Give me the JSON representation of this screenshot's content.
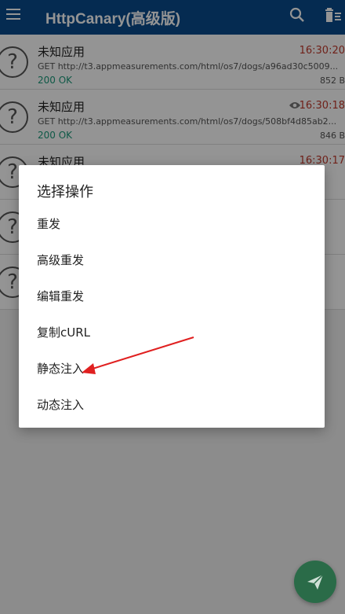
{
  "appbar": {
    "title": "HttpCanary(高级版)"
  },
  "requests": [
    {
      "app": "未知应用",
      "time": "16:30:20",
      "url": "GET http://t3.appmeasurements.com/html/os7/dogs/a96ad30c5009...",
      "status": "200 OK",
      "size": "852 B",
      "viewed": false
    },
    {
      "app": "未知应用",
      "time": "16:30:18",
      "url": "GET http://t3.appmeasurements.com/html/os7/dogs/508bf4d85ab2...",
      "status": "200 OK",
      "size": "846 B",
      "viewed": true
    },
    {
      "app": "未知应用",
      "time": "16:30:17",
      "url": "",
      "status": "",
      "size": "",
      "viewed": false
    }
  ],
  "dialog": {
    "title": "选择操作",
    "options": [
      "重发",
      "高级重发",
      "编辑重发",
      "复制cURL",
      "静态注入",
      "动态注入"
    ]
  },
  "colors": {
    "appbar": "#0a4a8c",
    "time": "#c0392b",
    "status": "#1a9a7a",
    "fab": "#2a6b48",
    "arrow": "#e02020"
  },
  "icons": [
    "menu-icon",
    "search-icon",
    "trash-icon",
    "eye-icon",
    "send-icon",
    "question-icon"
  ]
}
